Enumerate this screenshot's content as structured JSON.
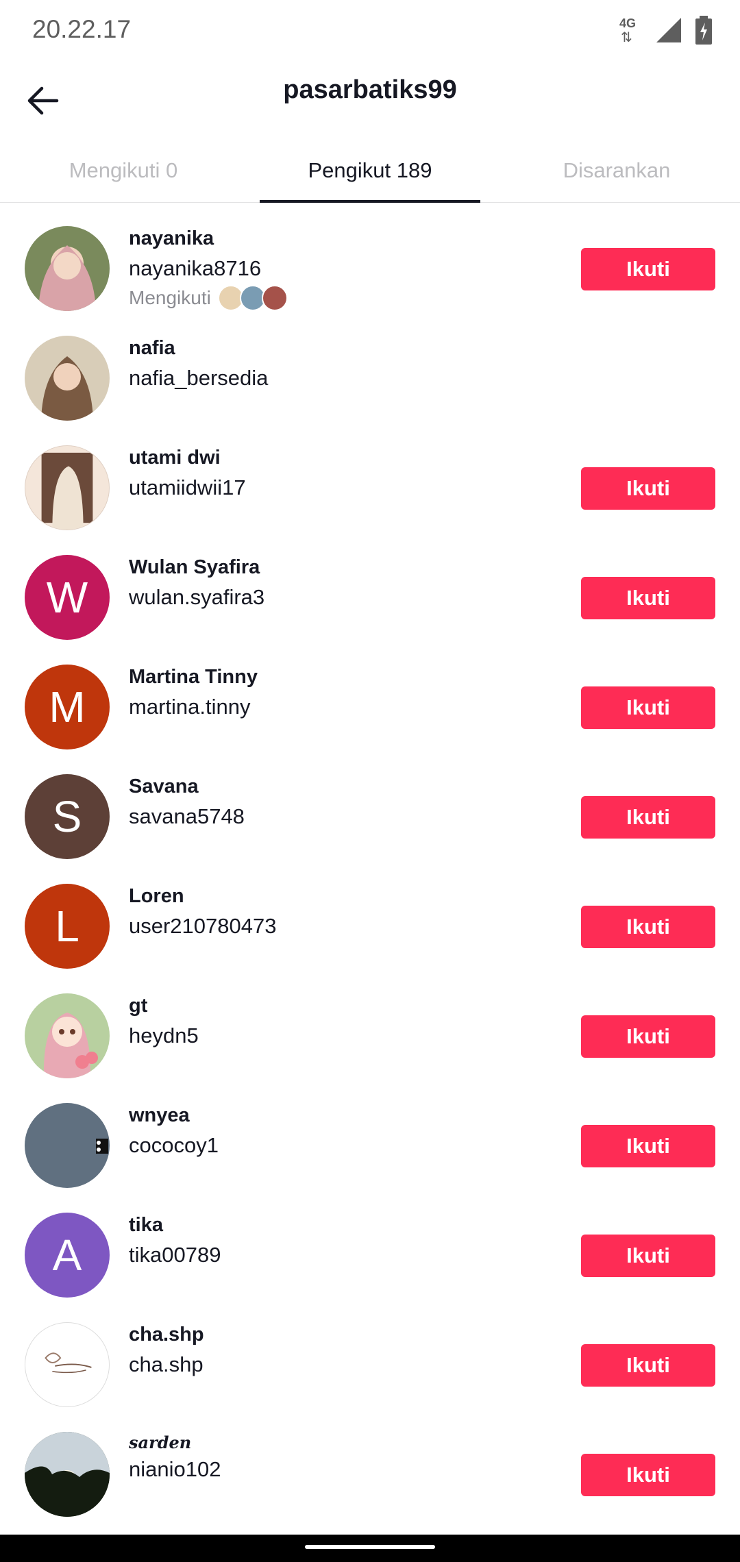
{
  "status_bar": {
    "time": "20.22.17",
    "network": "4G"
  },
  "header": {
    "title": "pasarbatiks99"
  },
  "tabs": [
    {
      "label": "Mengikuti 0",
      "active": false
    },
    {
      "label": "Pengikut 189",
      "active": true
    },
    {
      "label": "Disarankan",
      "active": false
    }
  ],
  "followers": [
    {
      "display_name": "nayanika",
      "username": "nayanika8716",
      "mutual_label": "Mengikuti",
      "button": "Ikuti",
      "avatar_letter": "",
      "avatar_color": "#7a8a5c"
    },
    {
      "display_name": "nafia",
      "username": "nafia_bersedia",
      "button": "",
      "avatar_letter": "",
      "avatar_color": "#b59b7a"
    },
    {
      "display_name": "utami dwi",
      "username": "utamiidwii17",
      "button": "Ikuti",
      "avatar_letter": "",
      "avatar_color": "#e8d6c6"
    },
    {
      "display_name": "Wulan Syafira",
      "username": "wulan.syafira3",
      "button": "Ikuti",
      "avatar_letter": "W",
      "avatar_color": "#c2185b"
    },
    {
      "display_name": "Martina Tinny",
      "username": "martina.tinny",
      "button": "Ikuti",
      "avatar_letter": "M",
      "avatar_color": "#bf360c"
    },
    {
      "display_name": "Savana",
      "username": "savana5748",
      "button": "Ikuti",
      "avatar_letter": "S",
      "avatar_color": "#5d4037"
    },
    {
      "display_name": "Loren",
      "username": "user210780473",
      "button": "Ikuti",
      "avatar_letter": "L",
      "avatar_color": "#bf360c"
    },
    {
      "display_name": "gt",
      "username": "heydn5",
      "button": "Ikuti",
      "avatar_letter": "",
      "avatar_color": "#e9c9c9"
    },
    {
      "display_name": "wnyea",
      "username": "cococoy1",
      "button": "Ikuti",
      "avatar_letter": "",
      "avatar_color": "#607080"
    },
    {
      "display_name": "tika",
      "username": "tika00789",
      "button": "Ikuti",
      "avatar_letter": "A",
      "avatar_color": "#7e57c2"
    },
    {
      "display_name": "cha.shp",
      "username": "cha.shp",
      "button": "Ikuti",
      "avatar_letter": "",
      "avatar_color": "#ffffff"
    },
    {
      "display_name": "sarden",
      "username": "nianio102",
      "button": "Ikuti",
      "avatar_letter": "",
      "avatar_color": "#1f2a1a"
    }
  ]
}
